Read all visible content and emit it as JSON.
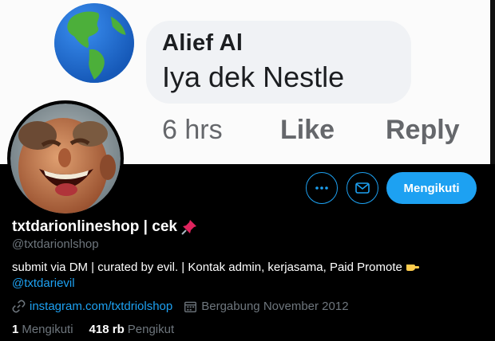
{
  "banner": {
    "comment_author": "Alief Al",
    "comment_text": "Iya dek Nestle",
    "time": "6 hrs",
    "like": "Like",
    "reply": "Reply"
  },
  "profile": {
    "display_name": "txtdarionlineshop | cek",
    "handle": "@txtdarionlshop",
    "bio": "submit via DM | curated by evil. | Kontak admin, kerjasama, Paid Promote",
    "bio_mention": "@txtdarievil",
    "link": "instagram.com/txtdriolshop",
    "joined": "Bergabung November 2012",
    "following_count": "1",
    "following_label": "Mengikuti",
    "followers_count": "418 rb",
    "followers_label": "Pengikut"
  },
  "actions": {
    "follow_label": "Mengikuti",
    "more_icon": "more-icon",
    "mail_icon": "mail-icon"
  },
  "colors": {
    "accent": "#1da1f2",
    "background": "#000000",
    "muted": "#6e767d"
  }
}
